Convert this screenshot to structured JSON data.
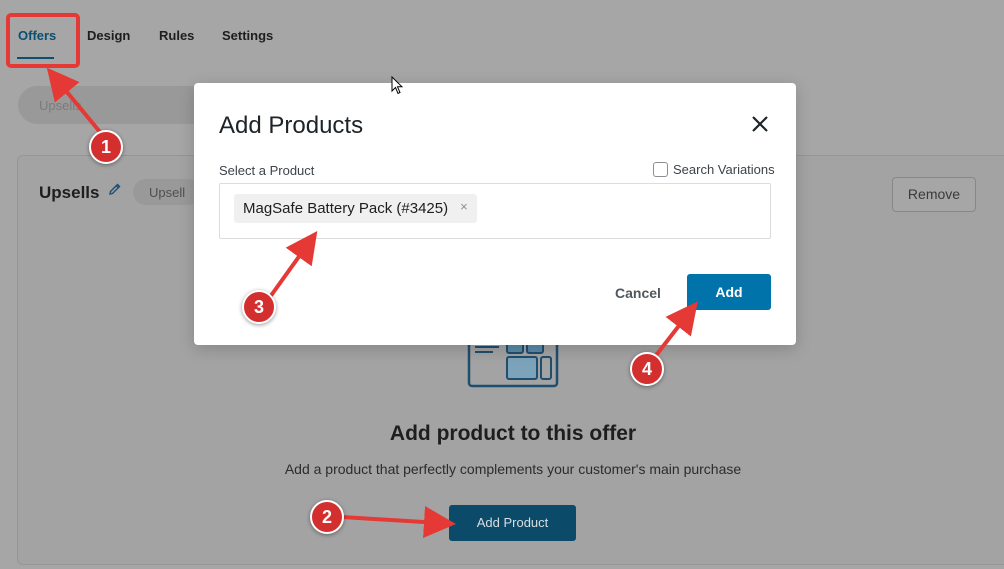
{
  "tabs": [
    {
      "label": "Offers"
    },
    {
      "label": "Design"
    },
    {
      "label": "Rules"
    },
    {
      "label": "Settings"
    }
  ],
  "upsells_pill": "Upsells",
  "offer": {
    "title": "Upsells",
    "type_badge": "Upsell",
    "remove_label": "Remove"
  },
  "empty_state": {
    "illustration_icon": "product-grid-icon",
    "title": "Add product to this offer",
    "description": "Add a product that perfectly complements your customer's main purchase",
    "button_label": "Add Product"
  },
  "modal": {
    "title": "Add Products",
    "select_label": "Select a Product",
    "search_variations_label": "Search Variations",
    "search_variations_checked": false,
    "selected_product": "MagSafe Battery Pack (#3425)",
    "remove_token_symbol": "×",
    "cancel_label": "Cancel",
    "add_label": "Add"
  },
  "annotations": {
    "steps": [
      "1",
      "2",
      "3",
      "4"
    ],
    "color": "#d32f2f"
  },
  "colors": {
    "accent": "#0073aa",
    "highlight": "#e53935"
  }
}
